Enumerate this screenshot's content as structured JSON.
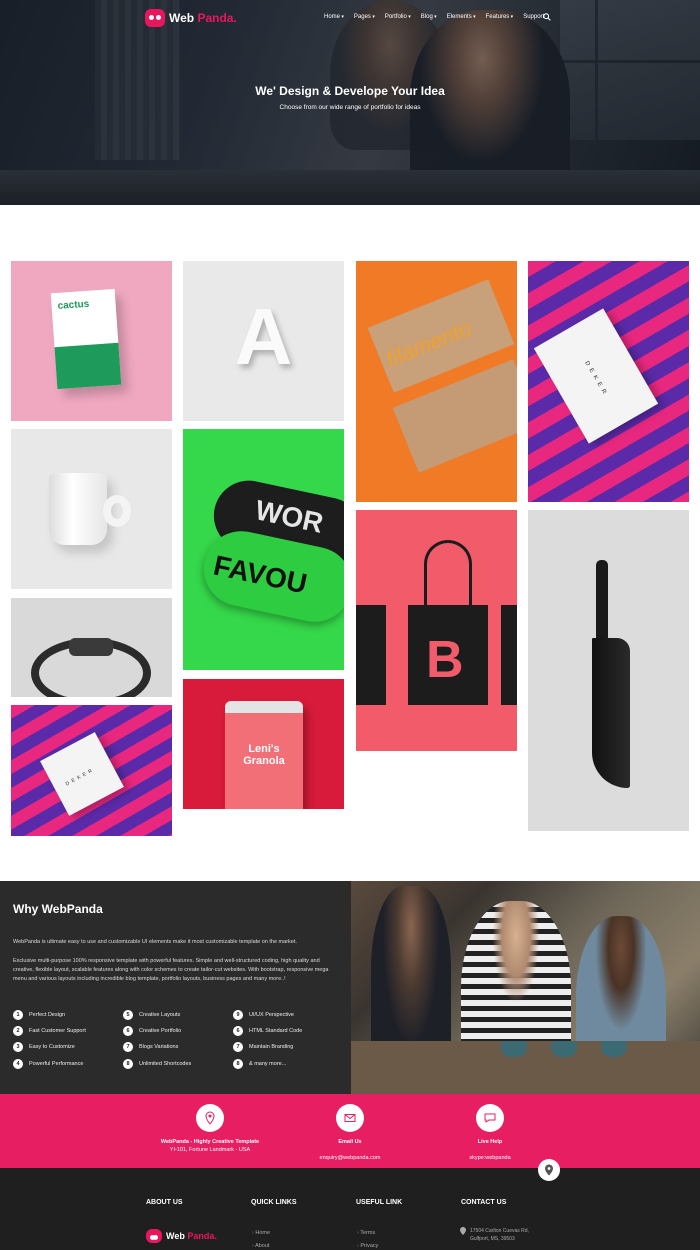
{
  "nav": {
    "brand_main": "Web",
    "brand_accent": "Panda.",
    "menu": [
      {
        "label": "Home",
        "dropdown": true
      },
      {
        "label": "Pages",
        "dropdown": true
      },
      {
        "label": "Portfolio",
        "dropdown": true
      },
      {
        "label": "Blog",
        "dropdown": true
      },
      {
        "label": "Elements",
        "dropdown": true
      },
      {
        "label": "Features",
        "dropdown": true
      },
      {
        "label": "Support",
        "dropdown": false
      }
    ],
    "search_icon": "search-icon"
  },
  "hero": {
    "title": "We' Design & Develope Your Idea",
    "subtitle": "Choose from our wide range of portfolio for ideas"
  },
  "portfolio": {
    "tiles": [
      {
        "id": "cactus",
        "text": "cactus"
      },
      {
        "id": "letter-a",
        "text": "A"
      },
      {
        "id": "filamento",
        "text": "filamento"
      },
      {
        "id": "deker-card",
        "text": "DEKER"
      },
      {
        "id": "mug",
        "text": ""
      },
      {
        "id": "green-tubes",
        "text_top": "WOR",
        "text_bottom": "FAVOU"
      },
      {
        "id": "tote-bags",
        "text": "B"
      },
      {
        "id": "knife",
        "text": ""
      },
      {
        "id": "watch",
        "text": ""
      },
      {
        "id": "granola",
        "text": "Leni's Granola"
      },
      {
        "id": "deker-box",
        "text": "DEKER"
      }
    ]
  },
  "why": {
    "title": "Why WebPanda",
    "paragraph1": "WebPanda is ultimate easy to use and customizable UI elements make it most customizable template on the market.",
    "paragraph2": "Exclusive multi-purpose 100% responsive template with powerful features. Simple and well-structured coding, high quality and creative, flexible layout, scalable features along with color schemes to create tailor-cut websites. With bootstrap, responsive mega menu and various layouts including incredible blog template, portfolio layouts, business pages and many more..!",
    "features": [
      {
        "num": "1",
        "label": "Perfect Design"
      },
      {
        "num": "2",
        "label": "Fast Customer Support"
      },
      {
        "num": "3",
        "label": "Easy to Customize"
      },
      {
        "num": "4",
        "label": "Powerful Performance"
      },
      {
        "num": "5",
        "label": "Creative Layouts"
      },
      {
        "num": "6",
        "label": "Creative Portfolio"
      },
      {
        "num": "7",
        "label": "Blogs Variations"
      },
      {
        "num": "8",
        "label": "Unlimited Shortcodes"
      },
      {
        "num": "9",
        "label": "UI/UX Perspective"
      },
      {
        "num": "6",
        "label": "HTML Standard Code"
      },
      {
        "num": "7",
        "label": "Maintain Branding"
      },
      {
        "num": "8",
        "label": "& many more..."
      }
    ]
  },
  "contact_bar": {
    "items": [
      {
        "icon": "map-icon",
        "title": "WebPanda - Highly Creative Template",
        "sub": "YI-101, Fortune Landmark - USA"
      },
      {
        "icon": "mail-icon",
        "title": "Email Us",
        "sub": "enquiry@webpanda.com"
      },
      {
        "icon": "chat-icon",
        "title": "Live Help",
        "sub": "skype:webpanda"
      }
    ]
  },
  "footer": {
    "about_title": "ABOUT US",
    "quick_title": "QUICK LINKS",
    "useful_title": "USEFUL LINK",
    "contact_title": "CONTACT US",
    "quick_links": [
      "Home",
      "About"
    ],
    "useful_links": [
      "Terms",
      "Privacy"
    ],
    "address_line1": "17504 Carlton Cuevas Rd,",
    "address_line2": "Gulfport, MS, 39503"
  },
  "colors": {
    "accent": "#e81e63",
    "dark": "#2b2b2b",
    "footer": "#1f1f1f"
  }
}
